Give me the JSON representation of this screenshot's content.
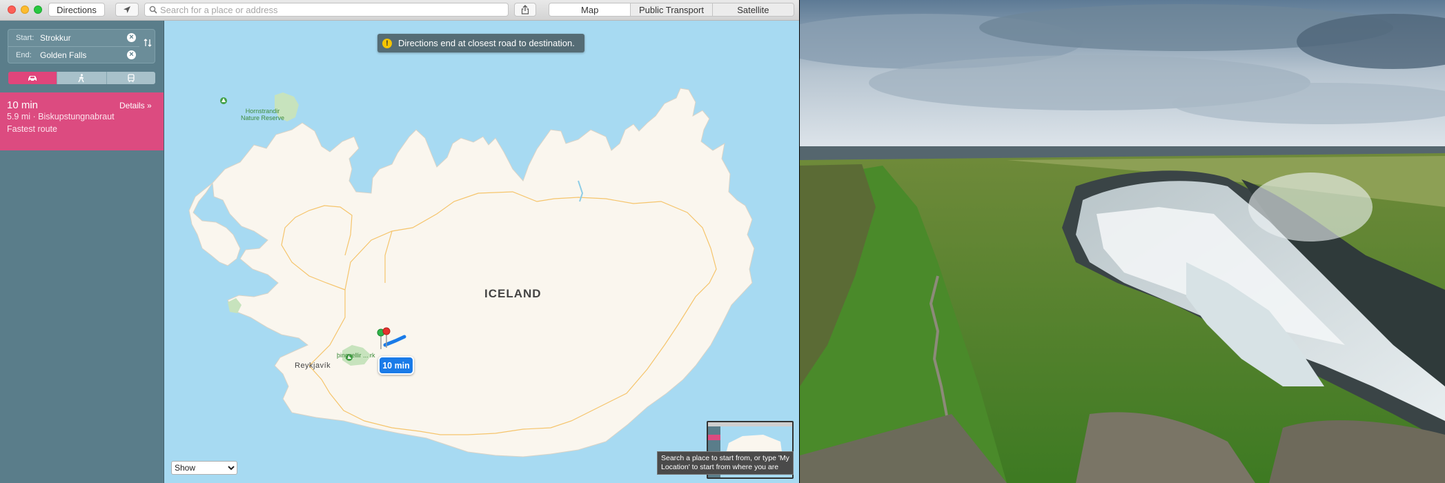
{
  "toolbar": {
    "directions_label": "Directions",
    "search_placeholder": "Search for a place or address",
    "view_modes": [
      {
        "label": "Map",
        "active": true
      },
      {
        "label": "Public Transport",
        "active": false
      },
      {
        "label": "Satellite",
        "active": false
      }
    ]
  },
  "sidebar": {
    "start_label": "Start:",
    "start_value": "Strokkur",
    "end_label": "End:",
    "end_value": "Golden Falls",
    "transport_modes": [
      {
        "icon": "car-icon",
        "active": true
      },
      {
        "icon": "walking-icon",
        "active": false
      },
      {
        "icon": "transit-icon",
        "active": false
      }
    ],
    "route": {
      "time": "10 min",
      "detail": "5.9 mi · Biskupstungnabraut",
      "note": "Fastest route",
      "details_link": "Details »"
    }
  },
  "map": {
    "notice": "Directions end at closest road to destination.",
    "country_label": "ICELAND",
    "city_label": "Reykjavík",
    "park_label_line1": "Hornstrandir",
    "park_label_line2": "Nature Reserve",
    "thingvellir_label": "þingvellir ... rk",
    "route_bubble": "10 min",
    "show_select": "Show",
    "tooltip": "Search a place to start from, or type 'My Location' to start from where you are"
  },
  "colors": {
    "accent": "#dc4b80",
    "sidebar": "#5a7d8a",
    "water": "#a7daf2",
    "land": "#faf6ee",
    "route_blue": "#1a7be8"
  },
  "photo": {
    "subject": "waterfall-photo"
  }
}
